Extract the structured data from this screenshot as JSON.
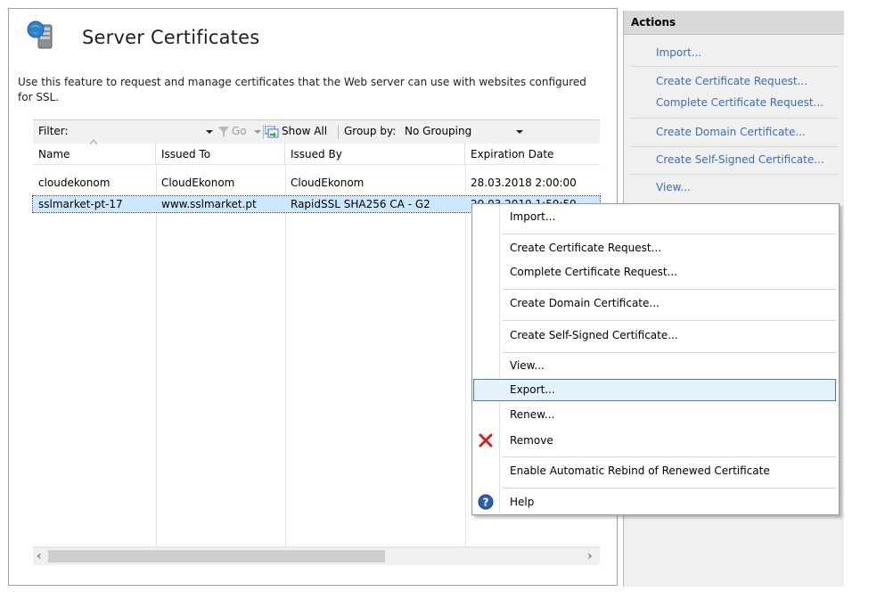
{
  "header": {
    "title": "Server Certificates",
    "description": "Use this feature to request and manage certificates that the Web server can use with websites configured for SSL."
  },
  "filterbar": {
    "filter_label": "Filter:",
    "filter_value": "",
    "go_label": "Go",
    "show_all_label": "Show All",
    "group_by_label": "Group by:",
    "group_by_value": "No Grouping"
  },
  "table": {
    "columns": [
      "Name",
      "Issued To",
      "Issued By",
      "Expiration Date"
    ],
    "rows": [
      {
        "name": "cloudekonom",
        "issued_to": "CloudEkonom",
        "issued_by": "CloudEkonom",
        "expiration": "28.03.2018 2:00:00"
      },
      {
        "name": "sslmarket-pt-17",
        "issued_to": "www.sslmarket.pt",
        "issued_by": "RapidSSL SHA256 CA - G2",
        "expiration": "29.03.2019 1:59:59"
      }
    ]
  },
  "actions": {
    "header": "Actions",
    "items": [
      "Import...",
      "Create Certificate Request...",
      "Complete Certificate Request...",
      "Create Domain Certificate...",
      "Create Self-Signed Certificate...",
      "View..."
    ]
  },
  "context_menu": {
    "items": [
      "Import...",
      "Create Certificate Request...",
      "Complete Certificate Request...",
      "Create Domain Certificate...",
      "Create Self-Signed Certificate...",
      "View...",
      "Export...",
      "Renew...",
      "Remove",
      "Enable Automatic Rebind of Renewed Certificate",
      "Help"
    ],
    "highlighted": "Export..."
  },
  "colors": {
    "link": "#3a6fb7",
    "selection": "#cce8ff",
    "menu_highlight": "#e5f1fb",
    "remove_icon": "#d42020",
    "help_icon": "#2a5fb5"
  },
  "icons": {
    "title": "certificate-server-icon",
    "go": "funnel-icon",
    "show_all": "show-all-icon",
    "remove": "red-x-icon",
    "help": "help-icon"
  }
}
